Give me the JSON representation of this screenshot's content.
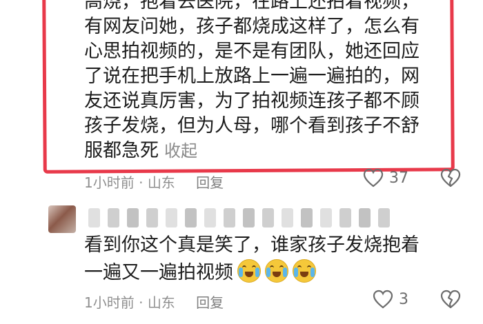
{
  "comment_1": {
    "lines": [
      "高烧，抱着去医院，在路上还拍着视频，",
      "有网友问她，孩子都烧成这样了，怎么有",
      "心思拍视频的，是不是有团队，她还回应",
      "了说在把手机上放路上一遍一遍拍的，网",
      "友还说真厉害，为了拍视频连孩子都不顾",
      "孩子发烧，但为人母，哪个看到孩子不舒",
      "服都急死"
    ],
    "collapse_label": "收起",
    "time": "1小时前",
    "location": "山东",
    "reply_label": "回复",
    "like_count": "37",
    "highlight_color": "#e8394a"
  },
  "comment_2": {
    "lines": [
      "看到你这个真是笑了，谁家孩子发烧抱着",
      "一遍又一遍拍视频"
    ],
    "emoji_icons": [
      "crying-laughing-emoji",
      "crying-laughing-emoji",
      "crying-laughing-emoji"
    ],
    "time": "1小时前",
    "location": "山东",
    "reply_label": "回复",
    "like_count": "3"
  },
  "separator": "·"
}
